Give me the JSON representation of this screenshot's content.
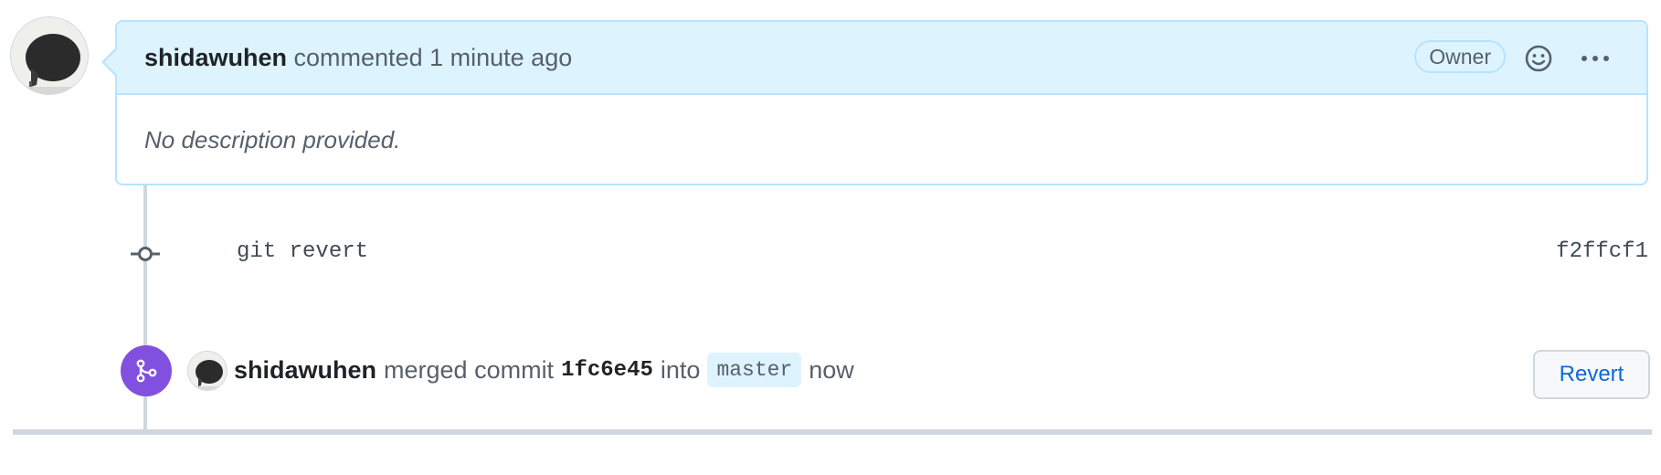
{
  "comment": {
    "author": "shidawuhen",
    "action": "commented",
    "time": "1 minute ago",
    "role_badge": "Owner",
    "body": "No description provided."
  },
  "commit": {
    "message": "git revert",
    "sha": "f2ffcf1"
  },
  "merge_event": {
    "author": "shidawuhen",
    "action": "merged commit",
    "commit_sha": "1fc6e45",
    "preposition": "into",
    "branch": "master",
    "time": "now",
    "revert_label": "Revert"
  },
  "icons": {
    "emoji": "smiley-icon",
    "more": "kebab-horizontal-icon",
    "commit": "git-commit-icon",
    "merge": "git-merge-icon"
  },
  "colors": {
    "header_bg": "#ddf4ff",
    "border_accent": "#b6e3ff",
    "merged_purple": "#8250df",
    "link_blue": "#0969da"
  }
}
